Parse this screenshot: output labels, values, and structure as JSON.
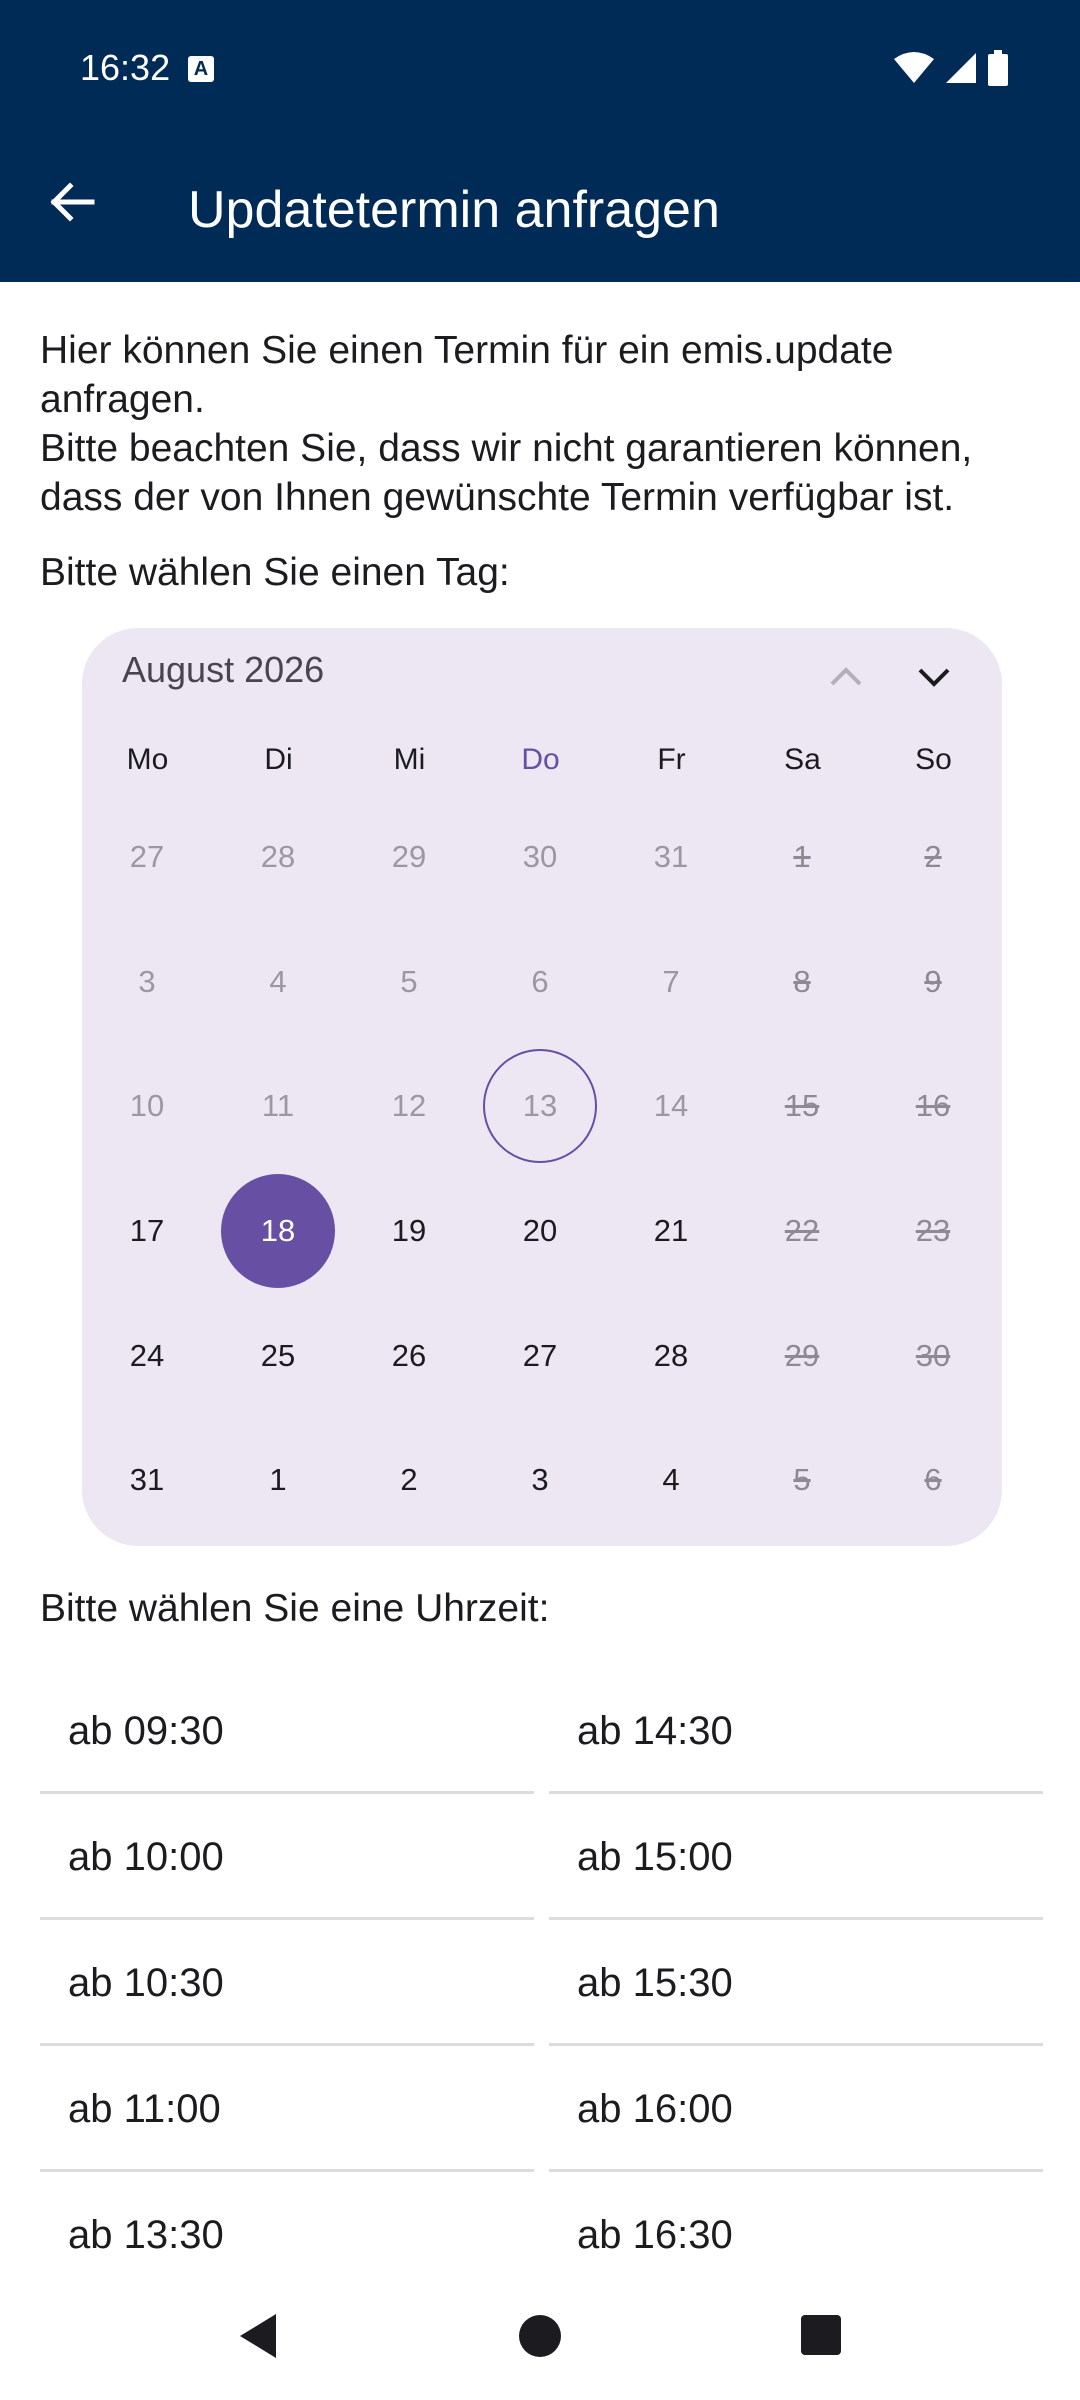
{
  "status": {
    "time": "16:32",
    "notification_glyph": "A"
  },
  "appbar": {
    "title": "Updatetermin anfragen"
  },
  "intro": "Hier können Sie einen Termin für ein emis.update\nanfragen.\nBitte beachten Sie, dass wir nicht garantieren können,\ndass der von Ihnen gewünschte Termin verfügbar ist.",
  "day_prompt": "Bitte wählen Sie einen Tag:",
  "calendar": {
    "month_label": "August 2026",
    "weekdays": [
      "Mo",
      "Di",
      "Mi",
      "Do",
      "Fr",
      "Sa",
      "So"
    ],
    "weeks": [
      [
        "27",
        "28",
        "29",
        "30",
        "31",
        "1",
        "2"
      ],
      [
        "3",
        "4",
        "5",
        "6",
        "7",
        "8",
        "9"
      ],
      [
        "10",
        "11",
        "12",
        "13",
        "14",
        "15",
        "16"
      ],
      [
        "17",
        "18",
        "19",
        "20",
        "21",
        "22",
        "23"
      ],
      [
        "24",
        "25",
        "26",
        "27",
        "28",
        "29",
        "30"
      ],
      [
        "31",
        "1",
        "2",
        "3",
        "4",
        "5",
        "6"
      ]
    ],
    "selected": "18",
    "today": "13"
  },
  "time_prompt": "Bitte wählen Sie eine Uhrzeit:",
  "times": {
    "left": [
      "ab 09:30",
      "ab 10:00",
      "ab 10:30",
      "ab 11:00",
      "ab 13:30"
    ],
    "right": [
      "ab 14:30",
      "ab 15:00",
      "ab 15:30",
      "ab 16:00",
      "ab 16:30"
    ]
  },
  "colors": {
    "appbar": "#002b57",
    "accent": "#6750a4",
    "calendar_bg": "#ede7f3"
  }
}
